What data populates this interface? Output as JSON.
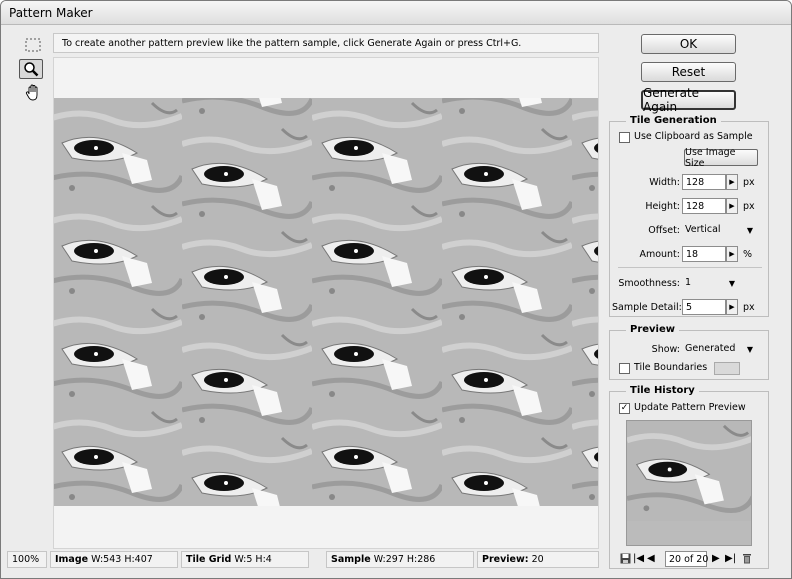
{
  "window": {
    "title": "Pattern Maker"
  },
  "message": "To create another pattern preview like the pattern sample, click Generate Again or press Ctrl+G.",
  "tools": [
    {
      "name": "marquee-tool",
      "icon": "dashed-rectangle-icon"
    },
    {
      "name": "zoom-tool",
      "icon": "magnifier-icon"
    },
    {
      "name": "hand-tool",
      "icon": "hand-icon"
    }
  ],
  "buttons": {
    "ok": "OK",
    "reset": "Reset",
    "generate_again": "Generate Again"
  },
  "tile_generation": {
    "legend": "Tile Generation",
    "use_clipboard_label": "Use Clipboard as Sample",
    "use_clipboard_checked": false,
    "use_image_size": "Use Image Size",
    "width_label": "Width:",
    "width_value": "128",
    "width_unit": "px",
    "height_label": "Height:",
    "height_value": "128",
    "height_unit": "px",
    "offset_label": "Offset:",
    "offset_value": "Vertical",
    "amount_label": "Amount:",
    "amount_value": "18",
    "amount_unit": "%",
    "smoothness_label": "Smoothness:",
    "smoothness_value": "1",
    "sample_detail_label": "Sample Detail:",
    "sample_detail_value": "5",
    "sample_detail_unit": "px"
  },
  "preview_group": {
    "legend": "Preview",
    "show_label": "Show:",
    "show_value": "Generated",
    "tile_boundaries_label": "Tile Boundaries",
    "tile_boundaries_checked": false,
    "boundary_color": "#d9d9d9"
  },
  "tile_history": {
    "legend": "Tile History",
    "update_label": "Update Pattern Preview",
    "update_checked": true,
    "counter": "20 of 20"
  },
  "status": {
    "zoom": "100%",
    "image_label": "Image",
    "image_value": "W:543 H:407",
    "grid_label": "Tile Grid",
    "grid_value": "W:5 H:4",
    "sample_label": "Sample",
    "sample_value": "W:297 H:286",
    "preview_label": "Preview:",
    "preview_value": "20"
  },
  "colors": {
    "window_bg": "#ececec",
    "button_border": "#6a6a6a"
  }
}
